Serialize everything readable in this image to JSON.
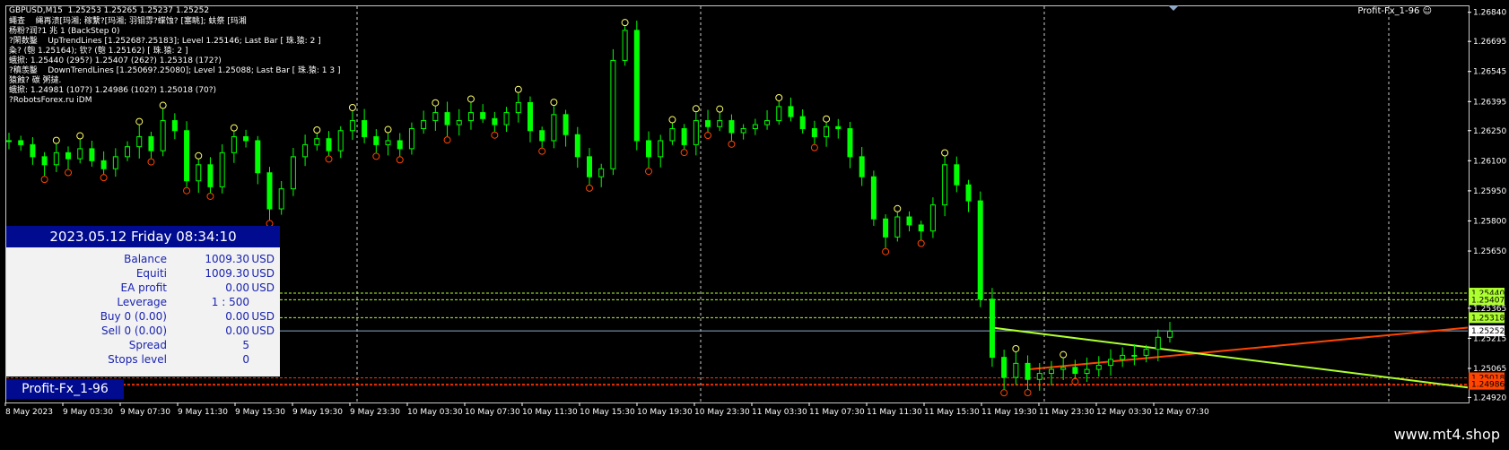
{
  "header": {
    "symbol_line": "GBPUSD,M15  1.25253 1.25265 1.25237 1.25252",
    "info_lines": [
      "蠅查    縄再溃[玛湘; 稼繫?[玛湘; 羽钼雰?蝶蚀? [塞眺]; 蚨祭 [玛湘",
      "杨粉?润?1 兆 1 (BackStep 0)",
      "?閑数鑿    UpTrendLines [1.25268?.25183]; Level 1.25146; Last Bar [ 珠.猿: 2 ]",
      "粂? (匏 1.25164); 钦? (匏 1.25162) [ 珠.猿: 2 ]",
      "蛾掀: 1.25440 (295?) 1.25407 (262?) 1.25318 (172?)",
      "?稹羡鑿    DownTrendLines [1.25069?.25080]; Level 1.25088; Last Bar [ 珠.猿: 1 3 ]",
      "猿蝕? 碳 粥撻.",
      "蛾掀: 1.24981 (107?) 1.24986 (102?) 1.25018 (70?)",
      "?RobotsForex.ru iDM"
    ],
    "indicator_name": "Profit-Fx_1-96",
    "smile_icon": "smiley-icon"
  },
  "panel": {
    "datetime": "2023.05.12   Friday   08:34:10",
    "rows": [
      {
        "label": "Balance",
        "value": "1009.30",
        "unit": "USD"
      },
      {
        "label": "Equiti",
        "value": "1009.30",
        "unit": "USD"
      },
      {
        "label": "EA profit",
        "value": "0.00",
        "unit": "USD"
      },
      {
        "label": "Leverage",
        "value": "1 : 500",
        "unit": ""
      },
      {
        "label": "Buy 0 (0.00)",
        "value": "0.00",
        "unit": "USD"
      },
      {
        "label": "Sell 0 (0.00)",
        "value": "0.00",
        "unit": "USD"
      },
      {
        "label": "Spread",
        "value": "5",
        "unit": ""
      },
      {
        "label": "Stops level",
        "value": "0",
        "unit": ""
      }
    ],
    "footer": "Profit-Fx_1-96"
  },
  "watermark": "www.mt4.shop",
  "colors": {
    "background": "#000000",
    "candles": "#00ff00",
    "panel_accent": "#000b8f",
    "up_trend": "#ff4500",
    "down_trend": "#adff2f",
    "resistance": "#adff2f",
    "support": "#ff3300",
    "bid_line": "#8aa8c8"
  },
  "chart_data": {
    "type": "candlestick",
    "symbol": "GBPUSD",
    "timeframe": "M15",
    "ohlc_last": {
      "open": 1.25253,
      "high": 1.25265,
      "low": 1.25237,
      "close": 1.25252
    },
    "x_tick_labels": [
      "8 May 2023",
      "9 May 03:30",
      "9 May 07:30",
      "9 May 11:30",
      "9 May 15:30",
      "9 May 19:30",
      "9 May 23:30",
      "10 May 03:30",
      "10 May 07:30",
      "10 May 11:30",
      "10 May 15:30",
      "10 May 19:30",
      "10 May 23:30",
      "11 May 03:30",
      "11 May 07:30",
      "11 May 11:30",
      "11 May 15:30",
      "11 May 19:30",
      "11 May 23:30",
      "12 May 03:30",
      "12 May 07:30"
    ],
    "y_tick_labels": [
      "1.26840",
      "1.26695",
      "1.26545",
      "1.26395",
      "1.26250",
      "1.26100",
      "1.25950",
      "1.25800",
      "1.25650",
      "1.25365",
      "1.25215",
      "1.25065",
      "1.24920"
    ],
    "ylim": [
      1.24895,
      1.2687
    ],
    "close_path": [
      1.262,
      1.2618,
      1.2612,
      1.2608,
      1.2614,
      1.2611,
      1.2616,
      1.261,
      1.2606,
      1.2612,
      1.2617,
      1.2622,
      1.2615,
      1.263,
      1.2625,
      1.26,
      1.2608,
      1.2597,
      1.2614,
      1.2622,
      1.262,
      1.2604,
      1.2586,
      1.2596,
      1.2612,
      1.2618,
      1.2621,
      1.2615,
      1.2625,
      1.263,
      1.2622,
      1.2618,
      1.262,
      1.2616,
      1.2626,
      1.263,
      1.2634,
      1.2628,
      1.263,
      1.2634,
      1.2631,
      1.2628,
      1.2634,
      1.2639,
      1.2625,
      1.262,
      1.2633,
      1.2623,
      1.2612,
      1.2602,
      1.2606,
      1.266,
      1.2675,
      1.262,
      1.2612,
      1.262,
      1.2626,
      1.2618,
      1.263,
      1.2627,
      1.263,
      1.2624,
      1.2626,
      1.2628,
      1.263,
      1.2637,
      1.2632,
      1.2626,
      1.2622,
      1.2627,
      1.2626,
      1.2612,
      1.2602,
      1.2581,
      1.2572,
      1.2582,
      1.2578,
      1.2575,
      1.2588,
      1.2608,
      1.2598,
      1.259,
      1.2541,
      1.2512,
      1.2502,
      1.2509,
      1.2501,
      1.2504,
      1.2506,
      1.2507,
      1.2504,
      1.2506,
      1.2508,
      1.2511,
      1.2513,
      1.2513,
      1.2516,
      1.2522,
      1.2525
    ],
    "resistance_levels": [
      1.2544,
      1.25407,
      1.25318
    ],
    "support_levels": [
      1.24981,
      1.24986,
      1.25018
    ],
    "bid": 1.25252,
    "price_labels": [
      "1.25440",
      "1.25407",
      "1.25318",
      "1.25252",
      "1.25018",
      "1.24986"
    ],
    "up_trend_line": {
      "start": 1.2506,
      "end": 1.25268
    },
    "down_trend_line": {
      "start": 1.25268,
      "end": 1.2497
    },
    "grid": false,
    "vertical_lines": 4
  }
}
